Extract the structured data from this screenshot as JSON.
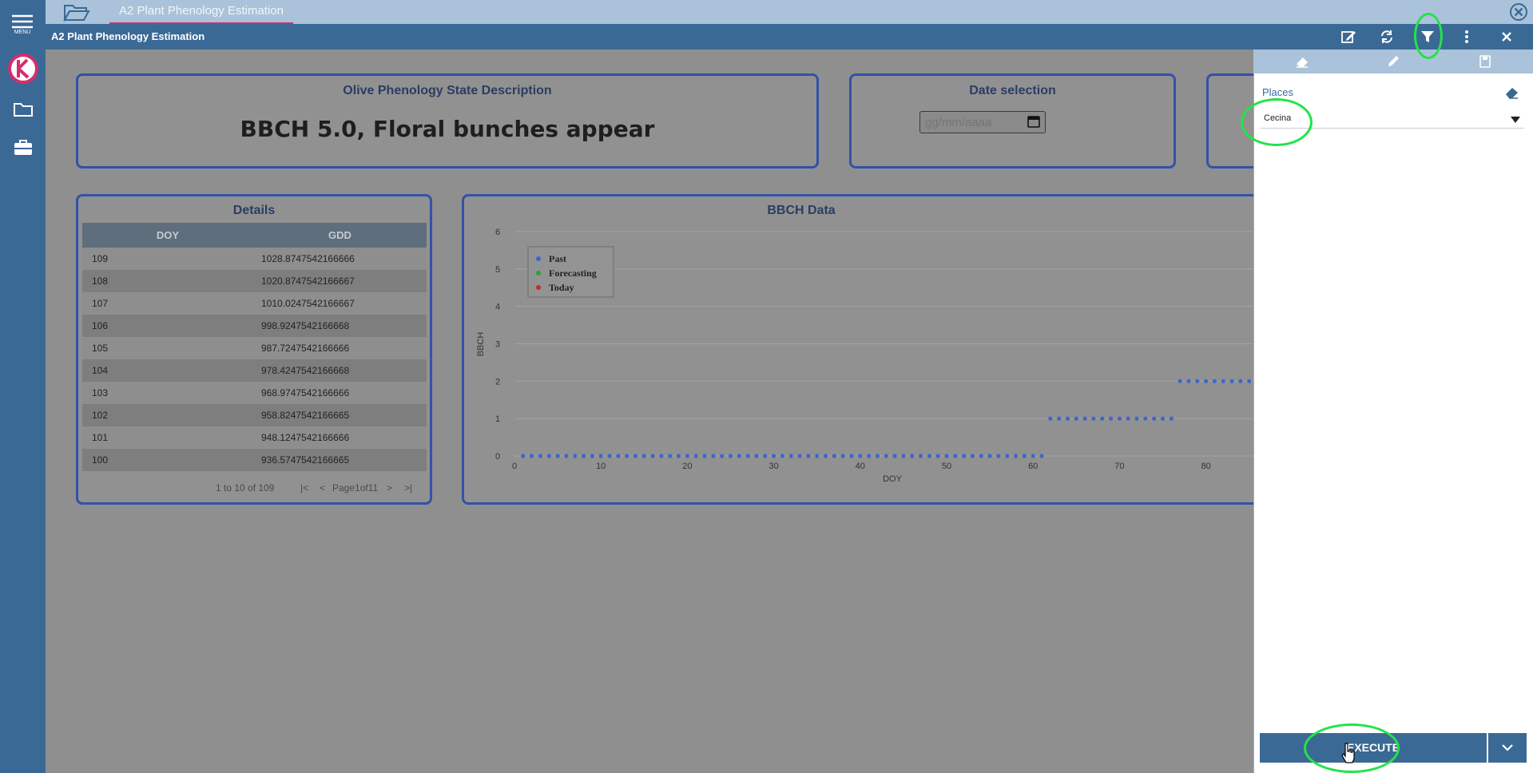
{
  "app": {
    "tab_title": "A2 Plant Phenology Estimation",
    "window_title": "A2 Plant Phenology Estimation",
    "menu_label": "MENU"
  },
  "cards": {
    "description": {
      "title": "Olive Phenology State Description",
      "text": "BBCH 5.0, Floral bunches appear"
    },
    "date": {
      "title": "Date selection",
      "placeholder": "gg/mm/aaaa"
    }
  },
  "details": {
    "title": "Details",
    "columns": [
      "DOY",
      "GDD"
    ],
    "rows": [
      [
        "109",
        "1028.8747542166666"
      ],
      [
        "108",
        "1020.8747542166667"
      ],
      [
        "107",
        "1010.0247542166667"
      ],
      [
        "106",
        "998.9247542166668"
      ],
      [
        "105",
        "987.7247542166666"
      ],
      [
        "104",
        "978.4247542166668"
      ],
      [
        "103",
        "968.9747542166666"
      ],
      [
        "102",
        "958.8247542166665"
      ],
      [
        "101",
        "948.1247542166666"
      ],
      [
        "100",
        "936.5747542166665"
      ]
    ],
    "pager": {
      "count": "1 to 10 of 109",
      "page": "Page1of11",
      "first": "|<",
      "prev": "<",
      "next": ">",
      "last": ">|"
    }
  },
  "chart_data": {
    "type": "scatter",
    "title": "BBCH Data",
    "xlabel": "DOY",
    "ylabel": "BBCH",
    "xlim": [
      0,
      86
    ],
    "ylim": [
      0,
      6
    ],
    "xticks": [
      0,
      10,
      20,
      30,
      40,
      50,
      60,
      70,
      80
    ],
    "yticks": [
      0,
      1,
      2,
      3,
      4,
      5,
      6
    ],
    "grid": true,
    "legend": "top-left",
    "legend_entries": [
      "Past",
      "Forecasting",
      "Today"
    ],
    "series_colors": {
      "Past": "#3f66c9",
      "Forecasting": "#2aa43a",
      "Today": "#c52a2a"
    },
    "series": [
      {
        "name": "Past",
        "segments": [
          {
            "x_from": 1,
            "x_to": 61,
            "y": 0
          },
          {
            "x_from": 62,
            "x_to": 76,
            "y": 1
          },
          {
            "x_from": 77,
            "x_to": 86,
            "y": 2
          }
        ]
      }
    ]
  },
  "panel": {
    "places_label": "Places",
    "places_value": "Cecina",
    "execute_label": "EXECUTE"
  },
  "colors": {
    "primary": "#3b6995",
    "accent": "#d32f6b",
    "highlight": "#22e34a"
  }
}
